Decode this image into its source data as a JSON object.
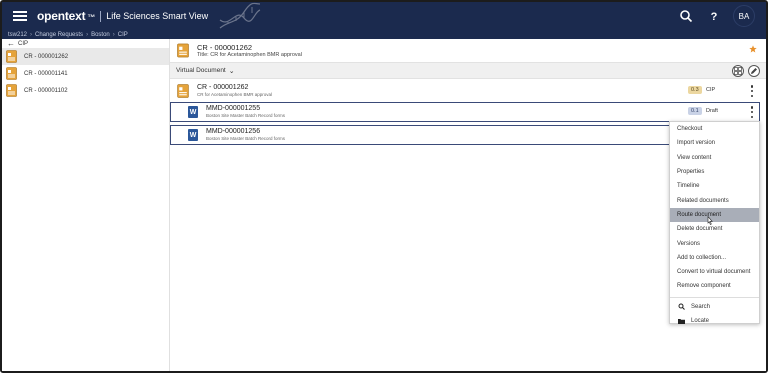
{
  "header": {
    "logo": "opentext",
    "logo_mark": "™",
    "app_name": "Life Sciences Smart View",
    "avatar_initials": "BA"
  },
  "breadcrumb": [
    "tsw212",
    "Change Requests",
    "Boston",
    "CIP"
  ],
  "left_panel": {
    "back_label": "CIP",
    "items": [
      {
        "label": "CR - 000001262",
        "selected": true
      },
      {
        "label": "CR - 000001141",
        "selected": false
      },
      {
        "label": "CR - 000001102",
        "selected": false
      }
    ]
  },
  "main": {
    "title": "CR - 000001262",
    "subtitle": "Title: CR for Acetaminophen BMR approval",
    "view_label": "Virtual Document",
    "parent_row": {
      "title": "CR - 000001262",
      "subtitle": "CR for Acetaminophen BMR approval",
      "version": "0.3",
      "state": "CIP"
    },
    "children": [
      {
        "title": "MMD-000001255",
        "subtitle": "Boston Site Master Batch Record forms",
        "version": "0.1",
        "state": "Draft"
      },
      {
        "title": "MMD-000001256",
        "subtitle": "Boston Site Master Batch Record forms"
      }
    ]
  },
  "context_menu": {
    "items": [
      "Checkout",
      "Import version",
      "View content",
      "Properties",
      "Timeline",
      "Related documents",
      "Route document",
      "Delete document",
      "Versions",
      "Add to collection...",
      "Convert to virtual document",
      "Remove component"
    ],
    "highlighted": "Route document",
    "extra_items": [
      {
        "label": "Search",
        "icon": "search-icon"
      },
      {
        "label": "Locate",
        "icon": "folder-icon"
      }
    ]
  },
  "colors": {
    "header_bg": "#1b2a4e",
    "folder_orange": "#e5a33a",
    "word_blue": "#2b579a",
    "star_orange": "#e8912c",
    "highlight": "#a9aeb8"
  }
}
